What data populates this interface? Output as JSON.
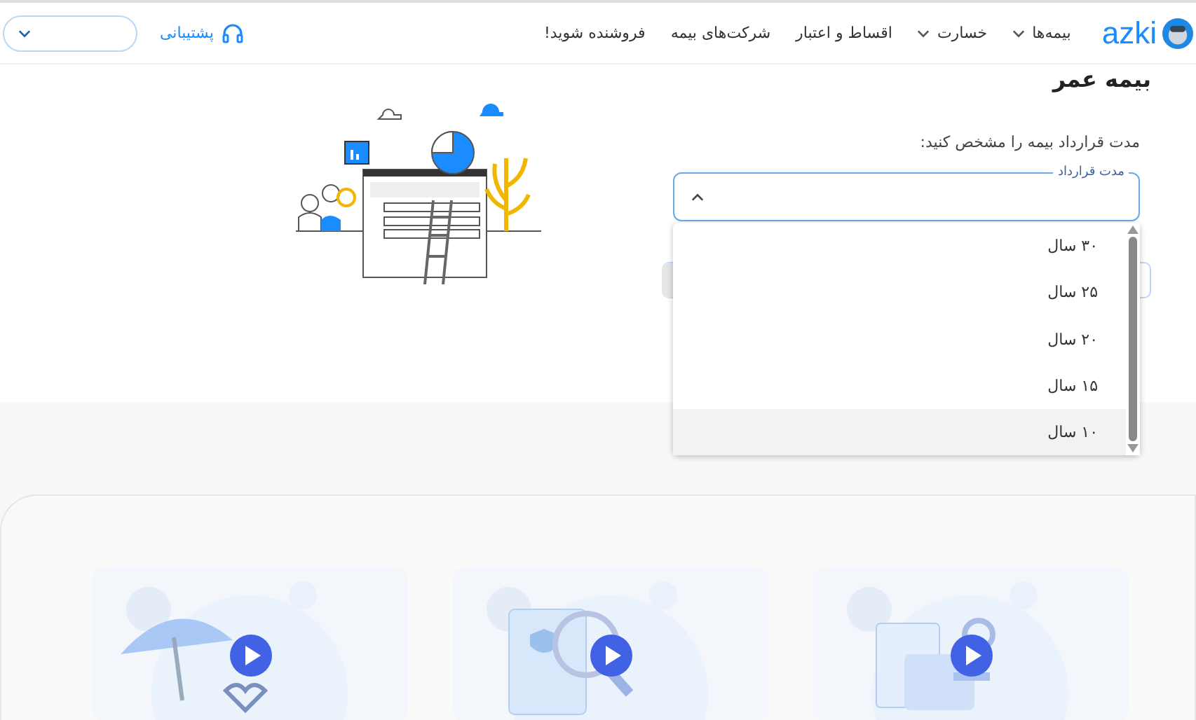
{
  "header": {
    "logo": "azki",
    "nav": [
      {
        "label": "بیمه‌ها",
        "dropdown": true
      },
      {
        "label": "خسارت",
        "dropdown": true
      },
      {
        "label": "اقساط و اعتبار",
        "dropdown": false
      },
      {
        "label": "شرکت‌های بیمه",
        "dropdown": false
      },
      {
        "label": "فروشنده شوید!",
        "dropdown": false
      }
    ],
    "support": "پشتیبانی"
  },
  "page": {
    "title": "بیمه عمر",
    "prompt": "مدت قرارداد بیمه را مشخص کنید:",
    "select": {
      "label": "مدت قرارداد",
      "expanded": true,
      "options": [
        {
          "label": "۳۰ سال",
          "selected": false
        },
        {
          "label": "۲۵ سال",
          "selected": false
        },
        {
          "label": "۲۰ سال",
          "selected": false
        },
        {
          "label": "۱۵ سال",
          "selected": false
        },
        {
          "label": "۱۰ سال",
          "selected": true
        }
      ]
    }
  },
  "videos": [
    {
      "kind": "clipboard"
    },
    {
      "kind": "document"
    },
    {
      "kind": "umbrella"
    }
  ]
}
